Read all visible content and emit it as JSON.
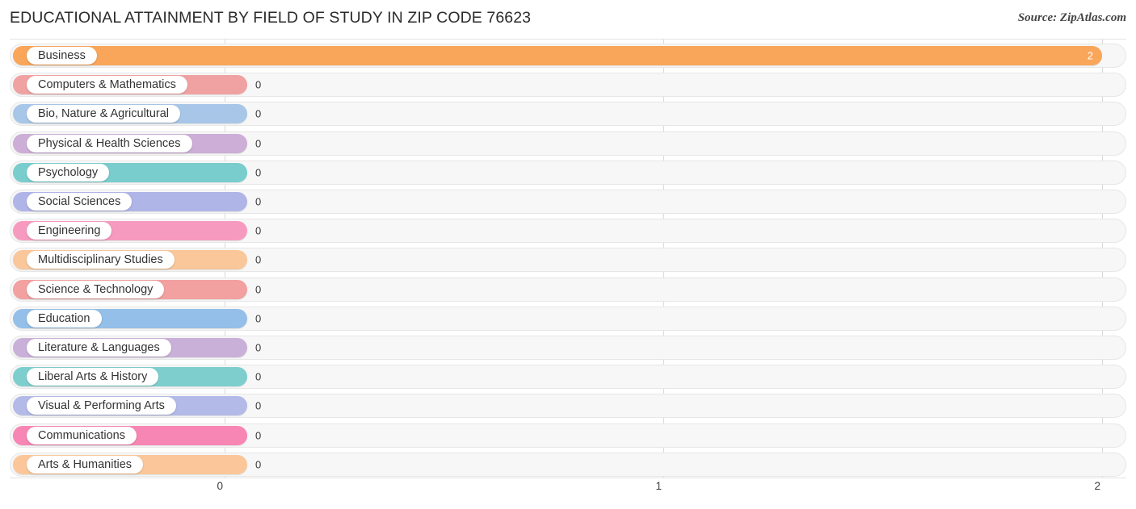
{
  "header": {
    "title": "EDUCATIONAL ATTAINMENT BY FIELD OF STUDY IN ZIP CODE 76623",
    "source": "Source: ZipAtlas.com"
  },
  "chart_data": {
    "type": "bar",
    "orientation": "horizontal",
    "title": "EDUCATIONAL ATTAINMENT BY FIELD OF STUDY IN ZIP CODE 76623",
    "xlabel": "",
    "ylabel": "",
    "xlim": [
      0,
      2
    ],
    "grid": true,
    "legend": "none",
    "tick_labels": [
      "0",
      "1",
      "2"
    ],
    "tick_values": [
      0,
      1,
      2
    ],
    "categories": [
      "Business",
      "Computers & Mathematics",
      "Bio, Nature & Agricultural",
      "Physical & Health Sciences",
      "Psychology",
      "Social Sciences",
      "Engineering",
      "Multidisciplinary Studies",
      "Science & Technology",
      "Education",
      "Literature & Languages",
      "Liberal Arts & History",
      "Visual & Performing Arts",
      "Communications",
      "Arts & Humanities"
    ],
    "values": [
      2,
      0,
      0,
      0,
      0,
      0,
      0,
      0,
      0,
      0,
      0,
      0,
      0,
      0,
      0
    ],
    "value_labels": [
      "2",
      "0",
      "0",
      "0",
      "0",
      "0",
      "0",
      "0",
      "0",
      "0",
      "0",
      "0",
      "0",
      "0",
      "0"
    ],
    "colors": [
      "#f9a65a",
      "#f0a2a2",
      "#a8c6e8",
      "#ccaed6",
      "#79cdcd",
      "#b0b5e8",
      "#f79ac0",
      "#fac79a",
      "#f2a0a0",
      "#94bfe8",
      "#c9b0d9",
      "#7fcece",
      "#b3bae8",
      "#f786b4",
      "#fbc79a"
    ]
  },
  "axis": {
    "ticks": [
      "0",
      "1",
      "2"
    ]
  }
}
